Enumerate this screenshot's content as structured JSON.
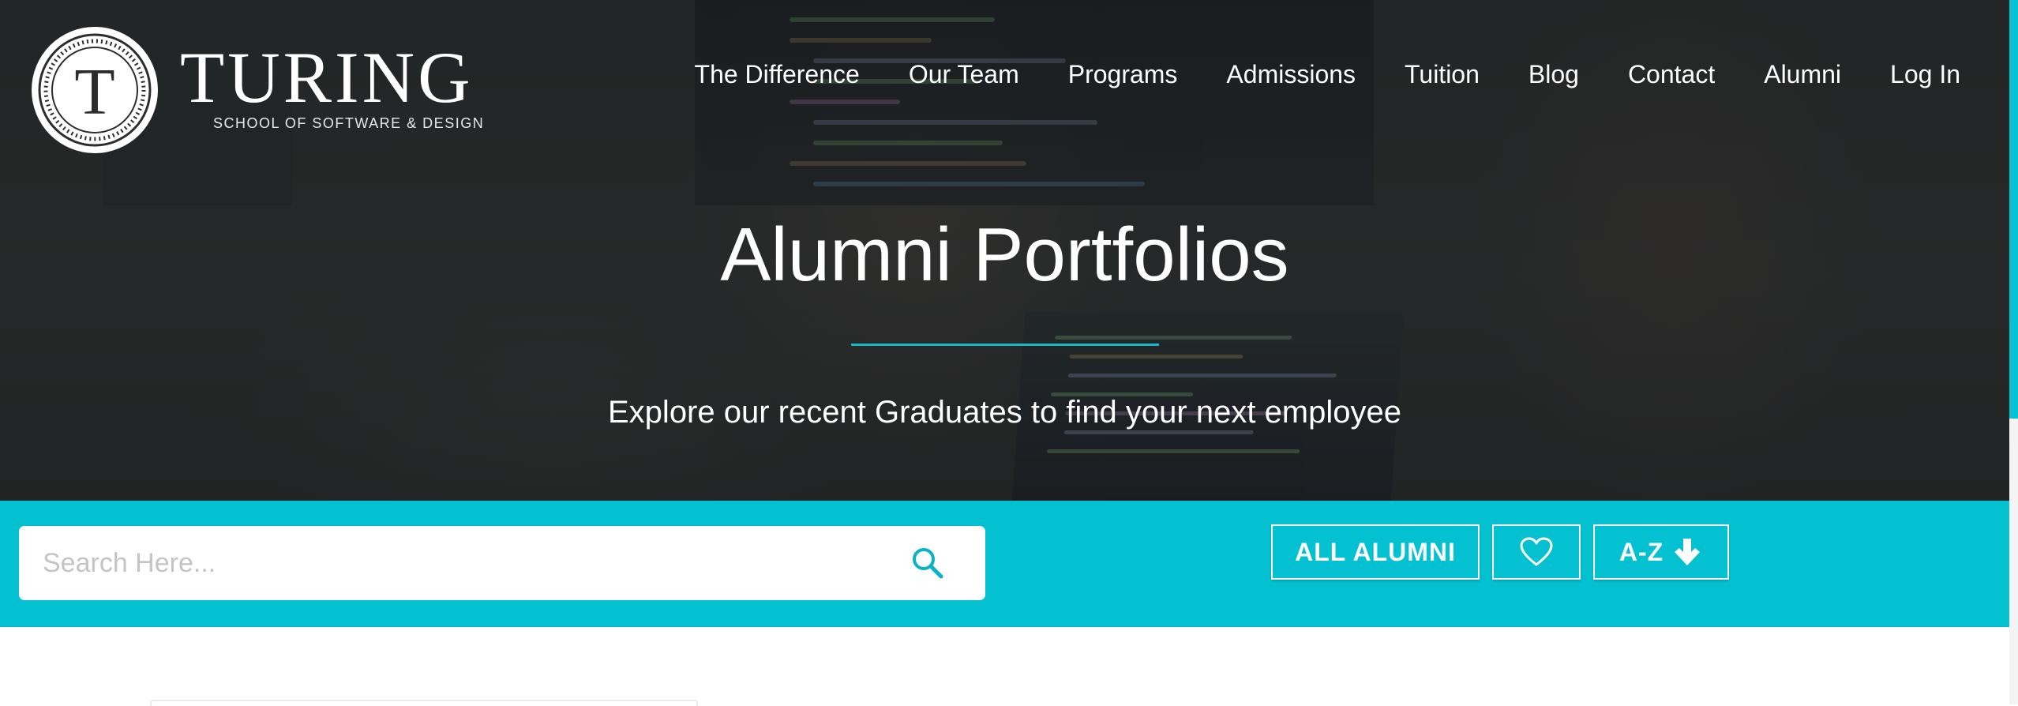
{
  "brand": {
    "seal_letter": "T",
    "wordmark": "TURING",
    "tagline": "SCHOOL OF SOFTWARE & DESIGN"
  },
  "nav": {
    "items": [
      {
        "label": "The Difference"
      },
      {
        "label": "Our Team"
      },
      {
        "label": "Programs"
      },
      {
        "label": "Admissions"
      },
      {
        "label": "Tuition"
      },
      {
        "label": "Blog"
      },
      {
        "label": "Contact"
      },
      {
        "label": "Alumni"
      },
      {
        "label": "Log In"
      }
    ]
  },
  "hero": {
    "title": "Alumni Portfolios",
    "subtitle": "Explore our recent Graduates to find your next employee"
  },
  "filters": {
    "search_placeholder": "Search Here...",
    "search_value": "",
    "search_icon": "search-icon",
    "all_alumni_label": "ALL ALUMNI",
    "favorites_icon": "heart-outline-icon",
    "sort_label": "A-Z",
    "sort_icon": "arrow-down-icon"
  },
  "colors": {
    "accent": "#04c1d1",
    "divider": "#18b7c8",
    "hero_text": "#ffffff",
    "placeholder": "#c4c4c4"
  }
}
